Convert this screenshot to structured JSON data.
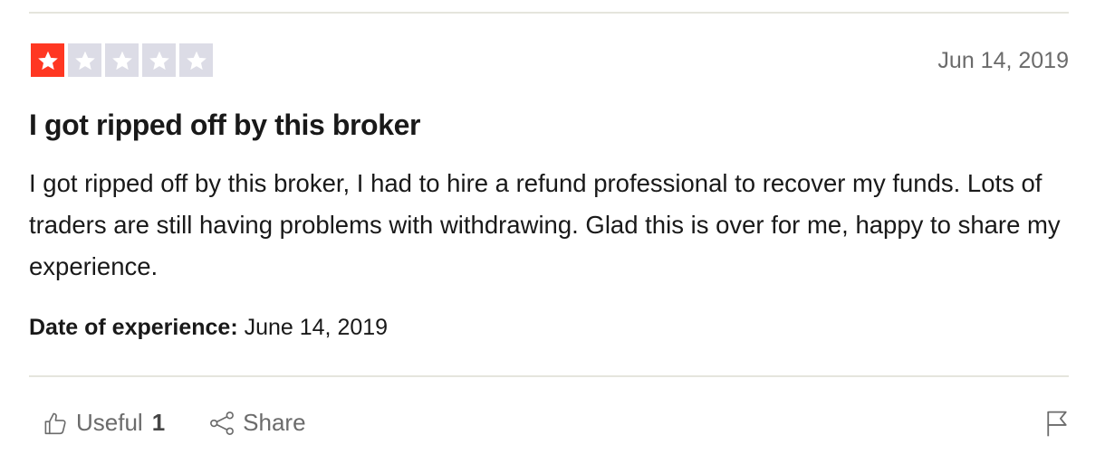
{
  "review": {
    "rating": 1,
    "max_rating": 5,
    "star_colors": {
      "filled": "#ff3722",
      "empty": "#dcdce6"
    },
    "published_date": "Jun 14, 2019",
    "title": "I got ripped off by this broker",
    "body": "I got ripped off by this broker, I had to hire a refund professional to recover my funds. Lots of traders are still having problems with withdrawing. Glad this is over for me, happy to share my experience.",
    "experience_label": "Date of experience:",
    "experience_date": "June 14, 2019"
  },
  "actions": {
    "useful_label": "Useful",
    "useful_count": "1",
    "share_label": "Share",
    "useful_icon": "thumbs-up-icon",
    "share_icon": "share-icon",
    "report_icon": "flag-icon"
  }
}
